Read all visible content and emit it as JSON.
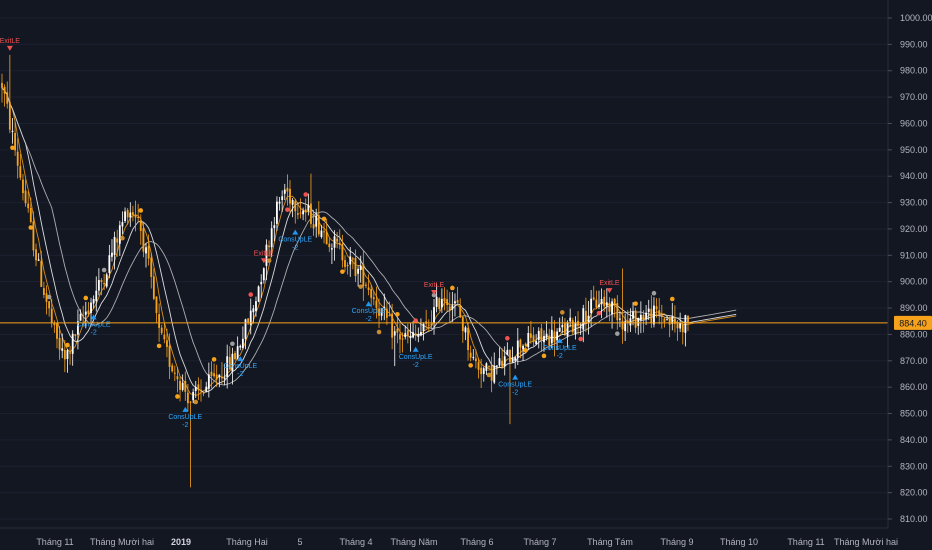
{
  "chart_data": {
    "type": "candlestick",
    "price_axis": {
      "range": [
        805,
        1005
      ],
      "ticks": [
        "1000.00",
        "990.00",
        "980.00",
        "970.00",
        "960.00",
        "950.00",
        "940.00",
        "930.00",
        "920.00",
        "910.00",
        "900.00",
        "890.00",
        "880.00",
        "870.00",
        "860.00",
        "850.00",
        "840.00",
        "830.00",
        "820.00",
        "810.00"
      ]
    },
    "time_axis": {
      "labels": [
        "Tháng 11",
        "Tháng Mười hai",
        "2019",
        "Tháng Hai",
        "5",
        "Tháng 4",
        "Tháng Năm",
        "Tháng 6",
        "Tháng 7",
        "Tháng Tám",
        "Tháng 9",
        "Tháng 10",
        "Tháng 11",
        "Tháng Mười hai"
      ],
      "bold": [
        false,
        false,
        true,
        false,
        false,
        false,
        false,
        false,
        false,
        false,
        false,
        false,
        false,
        false
      ]
    },
    "last_price": {
      "value": 884.4,
      "label": "884.40"
    },
    "close_anchors": [
      [
        0,
        975
      ],
      [
        8,
        935
      ],
      [
        14,
        905
      ],
      [
        20,
        880
      ],
      [
        24,
        870
      ],
      [
        30,
        885
      ],
      [
        38,
        900
      ],
      [
        48,
        928
      ],
      [
        52,
        925
      ],
      [
        56,
        905
      ],
      [
        60,
        880
      ],
      [
        64,
        870
      ],
      [
        72,
        855
      ],
      [
        80,
        862
      ],
      [
        88,
        870
      ],
      [
        96,
        890
      ],
      [
        104,
        925
      ],
      [
        108,
        935
      ],
      [
        112,
        930
      ],
      [
        118,
        925
      ],
      [
        124,
        918
      ],
      [
        132,
        908
      ],
      [
        138,
        902
      ],
      [
        144,
        890
      ],
      [
        150,
        880
      ],
      [
        156,
        878
      ],
      [
        162,
        882
      ],
      [
        168,
        895
      ],
      [
        174,
        890
      ],
      [
        180,
        870
      ],
      [
        186,
        865
      ],
      [
        192,
        870
      ],
      [
        198,
        877
      ],
      [
        204,
        878
      ],
      [
        212,
        880
      ],
      [
        220,
        885
      ],
      [
        228,
        893
      ],
      [
        234,
        890
      ],
      [
        238,
        884
      ],
      [
        246,
        888
      ],
      [
        252,
        887
      ],
      [
        258,
        883
      ],
      [
        262,
        885
      ]
    ],
    "volatility": 3.5,
    "colors": {
      "up": "#ffffff",
      "down": "#f7a21b",
      "ma_fast": "#f7a21b",
      "ma_mid": "#ffffff",
      "ma_slow": "#c8c8c8"
    },
    "signals": [
      {
        "i": 3,
        "type": "exit",
        "label": "ExitLE"
      },
      {
        "i": 35,
        "type": "entry",
        "label": "ConsUpLE",
        "sub": "-2"
      },
      {
        "i": 70,
        "type": "entry",
        "label": "ConsUpLE",
        "sub": "-2"
      },
      {
        "i": 91,
        "type": "entry",
        "label": "ConsUpLE",
        "sub": "-2"
      },
      {
        "i": 100,
        "type": "exit",
        "label": "ExitLE"
      },
      {
        "i": 112,
        "type": "entry",
        "label": "ConsUpLE",
        "sub": "-2"
      },
      {
        "i": 140,
        "type": "entry",
        "label": "ConsUpLE",
        "sub": "-2"
      },
      {
        "i": 158,
        "type": "entry",
        "label": "ConsUpLE",
        "sub": "-2"
      },
      {
        "i": 165,
        "type": "exit",
        "label": "ExitLE"
      },
      {
        "i": 196,
        "type": "entry",
        "label": "ConsUpLE",
        "sub": "-2"
      },
      {
        "i": 213,
        "type": "entry",
        "label": "ConsUpLE",
        "sub": "-2"
      },
      {
        "i": 232,
        "type": "exit",
        "label": "ExitLE"
      }
    ]
  }
}
